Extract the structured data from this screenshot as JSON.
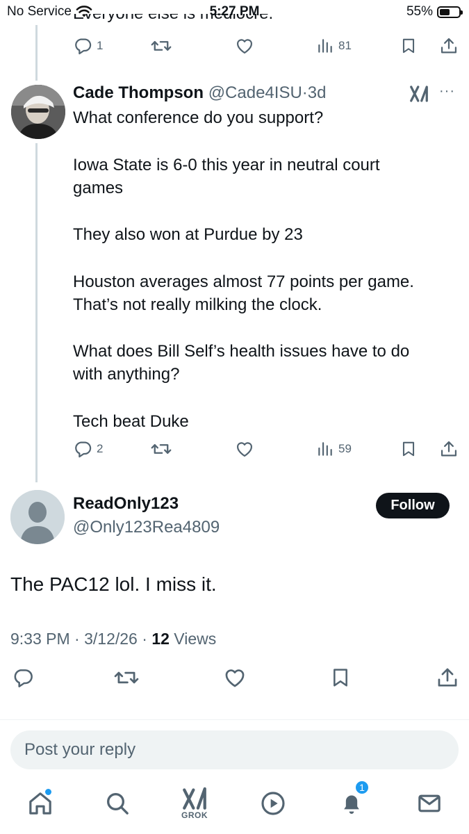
{
  "status_bar": {
    "carrier": "No Service",
    "time": "5:27 PM",
    "battery": "55%",
    "battery_level": 0.55
  },
  "previous_reply": {
    "clipped_text": "Everyone else is mediocre.",
    "stats": {
      "replies": "1",
      "views": "81"
    }
  },
  "tweet": {
    "name": "Cade Thompson",
    "handle": "@Cade4ISU",
    "separator": "·",
    "age": "3d",
    "lines": [
      "What conference do you support?",
      "Iowa State is 6-0 this year in neutral court",
      "games",
      "They also won at Purdue by 23",
      "Houston averages almost 77 points per game.",
      "That’s not really milking the clock.",
      "What does Bill Self’s health issues have to do",
      "with anything?",
      "Tech beat Duke"
    ],
    "stats": {
      "replies": "2",
      "views": "59"
    }
  },
  "main_post": {
    "name": "ReadOnly123",
    "handle": "@Only123Rea4809",
    "follow_label": "Follow",
    "text": "The PAC12 lol. I miss it.",
    "time": "9:33 PM",
    "date": "3/12/26",
    "views_count": "12",
    "views_label": "Views"
  },
  "reply": {
    "placeholder": "Post your reply"
  },
  "nav": {
    "grok_label": "GROK",
    "notifications_count": "1"
  },
  "icons": [
    "wifi-icon",
    "battery-icon",
    "reply-icon",
    "repost-icon",
    "like-icon",
    "views-icon",
    "bookmark-icon",
    "share-icon",
    "grok-icon",
    "more-icon",
    "home-icon",
    "search-icon",
    "video-icon",
    "bell-icon",
    "mail-icon"
  ],
  "colors": {
    "text": "#0f1419",
    "secondary": "#536471",
    "accent": "#1d9bf0",
    "thread_line": "#cfd9de"
  }
}
